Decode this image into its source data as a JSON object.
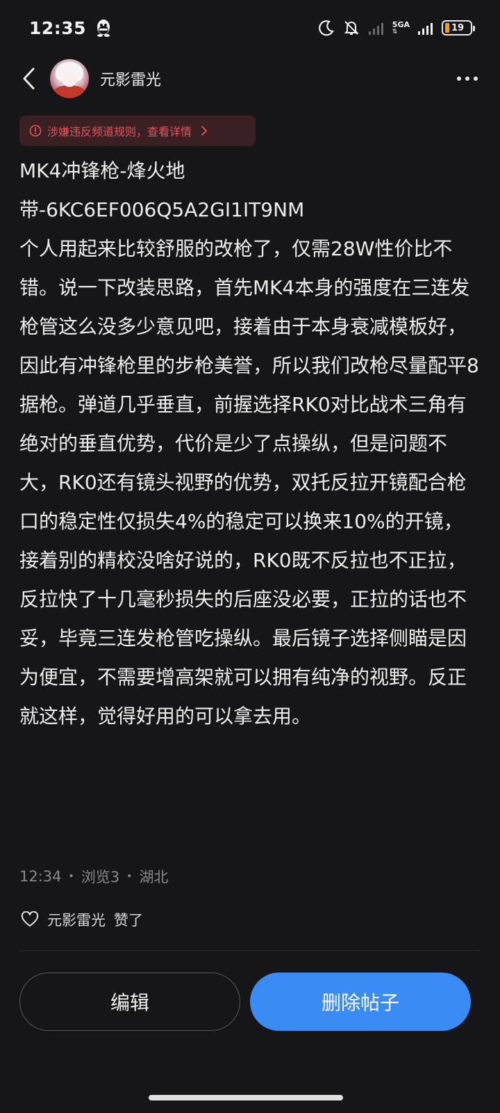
{
  "status_bar": {
    "time": "12:35",
    "network": "5GA",
    "battery": "19",
    "icons": [
      "qq-icon",
      "moon-icon",
      "bell-off-icon",
      "signal-weak-icon",
      "signal-strong-icon",
      "battery-icon"
    ]
  },
  "header": {
    "author": "元影雷光",
    "icons": [
      "back-chevron-icon",
      "more-dots-icon"
    ]
  },
  "warning": {
    "text": "涉嫌违反频道规则，查看详情",
    "color": "#e8545c"
  },
  "post": {
    "title_line1": "MK4冲锋枪-烽火地",
    "title_line2": "带-6KC6EF006Q5A2GI1IT9NM",
    "body": "个人用起来比较舒服的改枪了，仅需28W性价比不错。说一下改装思路，首先MK4本身的强度在三连发枪管这么没多少意见吧，接着由于本身衰减模板好，因此有冲锋枪里的步枪美誉，所以我们改枪尽量配平8据枪。弹道几乎垂直，前握选择RK0对比战术三角有绝对的垂直优势，代价是少了点操纵，但是问题不大，RK0还有镜头视野的优势，双托反拉开镜配合枪口的稳定性仅损失4%的稳定可以换来10%的开镜，接着别的精校没啥好说的，RK0既不反拉也不正拉，反拉快了十几毫秒损失的后座没必要，正拉的话也不妥，毕竟三连发枪管吃操纵。最后镜子选择侧瞄是因为便宜，不需要增高架就可以拥有纯净的视野。反正就这样，觉得好用的可以拿去用。"
  },
  "meta": {
    "time": "12:34",
    "views": "浏览3",
    "location": "湖北",
    "separator": "•"
  },
  "likes": {
    "user": "元影雷光",
    "action": "赞了"
  },
  "buttons": {
    "edit": "编辑",
    "delete": "删除帖子"
  },
  "colors": {
    "background": "#161618",
    "accent": "#3a8bf3",
    "warning": "#e8545c"
  }
}
